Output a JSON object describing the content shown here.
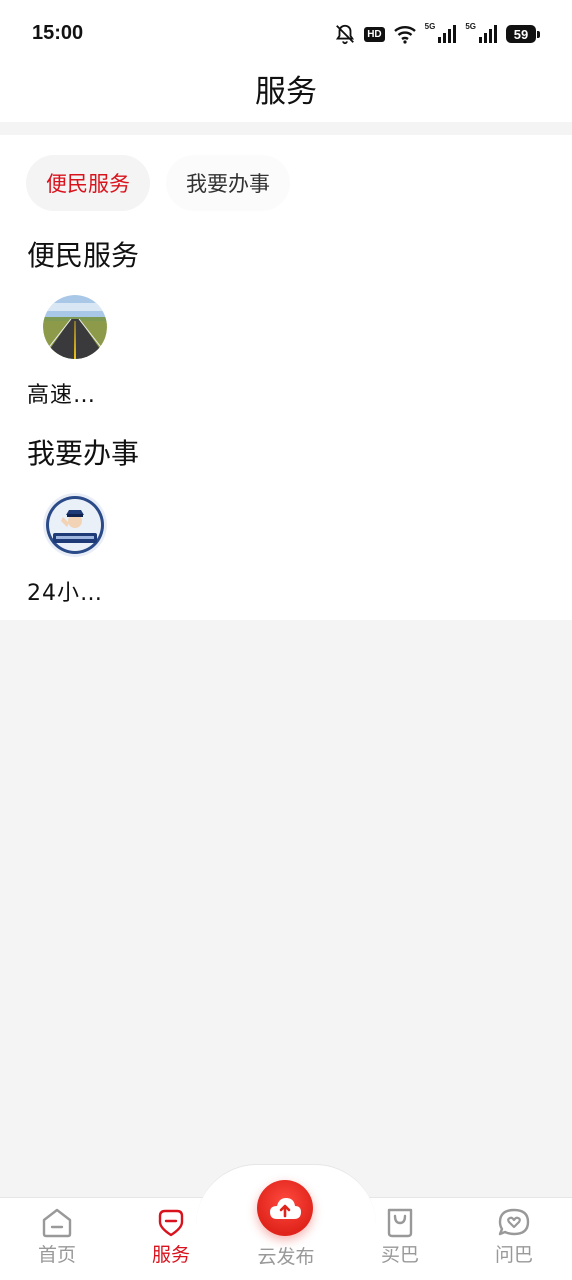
{
  "status_bar": {
    "time": "15:00",
    "hd_label": "HD",
    "network_1": "5G",
    "network_2": "5G",
    "battery": "59"
  },
  "header": {
    "title": "服务"
  },
  "tabs": [
    {
      "label": "便民服务",
      "active": true
    },
    {
      "label": "我要办事",
      "active": false
    }
  ],
  "sections": [
    {
      "title": "便民服务",
      "items": [
        {
          "label": "高速…",
          "icon": "highway-road-icon"
        }
      ]
    },
    {
      "title": "我要办事",
      "items": [
        {
          "label": "24小…",
          "icon": "police-officer-badge-icon"
        }
      ]
    }
  ],
  "bottom_nav": [
    {
      "label": "首页",
      "icon": "home-icon",
      "active": false
    },
    {
      "label": "服务",
      "icon": "service-icon",
      "active": true
    },
    {
      "label": "云发布",
      "icon": "cloud-upload-icon",
      "active": false
    },
    {
      "label": "买巴",
      "icon": "shopping-bag-icon",
      "active": false
    },
    {
      "label": "问巴",
      "icon": "chat-heart-icon",
      "active": false
    }
  ],
  "colors": {
    "accent": "#d9131d",
    "inactive": "#999999",
    "background": "#f4f4f4"
  }
}
